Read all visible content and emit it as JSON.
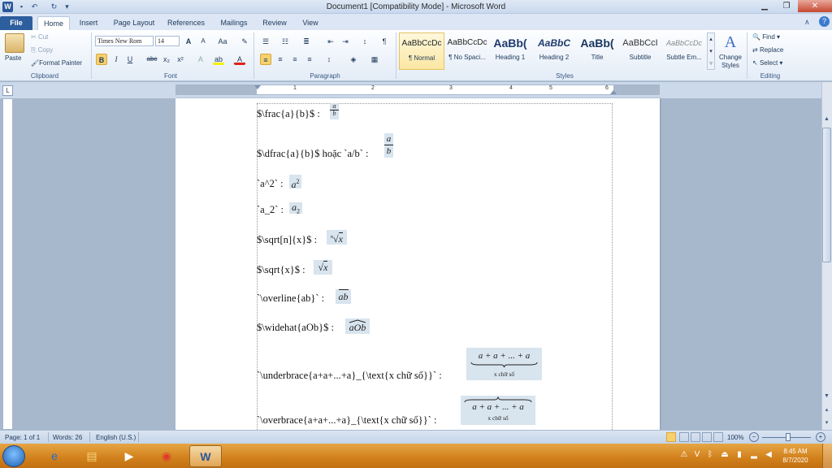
{
  "window": {
    "title": "Document1 [Compatibility Mode] - Microsoft Word"
  },
  "quick_access": {
    "word_icon": "word-icon",
    "save_icon": "save-icon",
    "undo_icon": "undo-icon",
    "redo_icon": "redo-icon"
  },
  "tabs": [
    {
      "label": "File"
    },
    {
      "label": "Home"
    },
    {
      "label": "Insert"
    },
    {
      "label": "Page Layout"
    },
    {
      "label": "References"
    },
    {
      "label": "Mailings"
    },
    {
      "label": "Review"
    },
    {
      "label": "View"
    }
  ],
  "clipboard": {
    "paste": "Paste",
    "cut": "Cut",
    "copy": "Copy",
    "format_painter": "Format Painter",
    "label": "Clipboard"
  },
  "font": {
    "family": "Times New Rom",
    "size": "14",
    "label": "Font",
    "bold": "B",
    "italic": "I",
    "underline": "U",
    "strike": "abc",
    "subscript": "x₂",
    "superscript": "x²",
    "grow": "A",
    "shrink": "A",
    "case": "Aa"
  },
  "paragraph": {
    "label": "Paragraph",
    "show_marks": "¶"
  },
  "styles": {
    "label": "Styles",
    "items": [
      {
        "preview": "AaBbCcDc",
        "name": "¶ Normal"
      },
      {
        "preview": "AaBbCcDc",
        "name": "¶ No Spaci..."
      },
      {
        "preview": "AaBb(",
        "name": "Heading 1"
      },
      {
        "preview": "AaBbC",
        "name": "Heading 2"
      },
      {
        "preview": "AaBb(",
        "name": "Title"
      },
      {
        "preview": "AaBbCcI",
        "name": "Subtitle"
      },
      {
        "preview": "AaBbCcDc",
        "name": "Subtle Em..."
      }
    ],
    "change_styles": "Change Styles"
  },
  "editing": {
    "label": "Editing",
    "find": "Find",
    "replace": "Replace",
    "select": "Select"
  },
  "ruler": {
    "numbers": [
      "1",
      "2",
      "3",
      "4",
      "5",
      "6"
    ]
  },
  "document": {
    "lines": [
      {
        "code": "$\\frac{a}{b}$ : "
      },
      {
        "code": "$\\dfrac{a}{b}$ hoặc `a/b` : "
      },
      {
        "code": "`a^2` : "
      },
      {
        "code": "`a_2` : "
      },
      {
        "code": "$\\sqrt[n]{x}$ : "
      },
      {
        "code": "$\\sqrt{x}$ : "
      },
      {
        "code": "`\\overline{ab}` : "
      },
      {
        "code": "$\\widehat{aOb}$ : "
      },
      {
        "code": "`\\underbrace{a+a+...+a}_{\\text{x chữ số}}` : "
      },
      {
        "code": "`\\overbrace{a+a+...+a}_{\\text{x chữ số}}` : "
      }
    ],
    "eq": {
      "a": "a",
      "b": "b",
      "a2base": "a",
      "two": "2",
      "n": "n",
      "x": "x",
      "ab": "ab",
      "aOb": "aOb",
      "sum": "a + a + ... + a",
      "xchu": "x chữ số"
    }
  },
  "status": {
    "page": "Page: 1 of 1",
    "words": "Words: 26",
    "language": "English (U.S.)",
    "zoom": "100%"
  },
  "taskbar": {
    "time": "8:45 AM",
    "date": "8/7/2020"
  }
}
